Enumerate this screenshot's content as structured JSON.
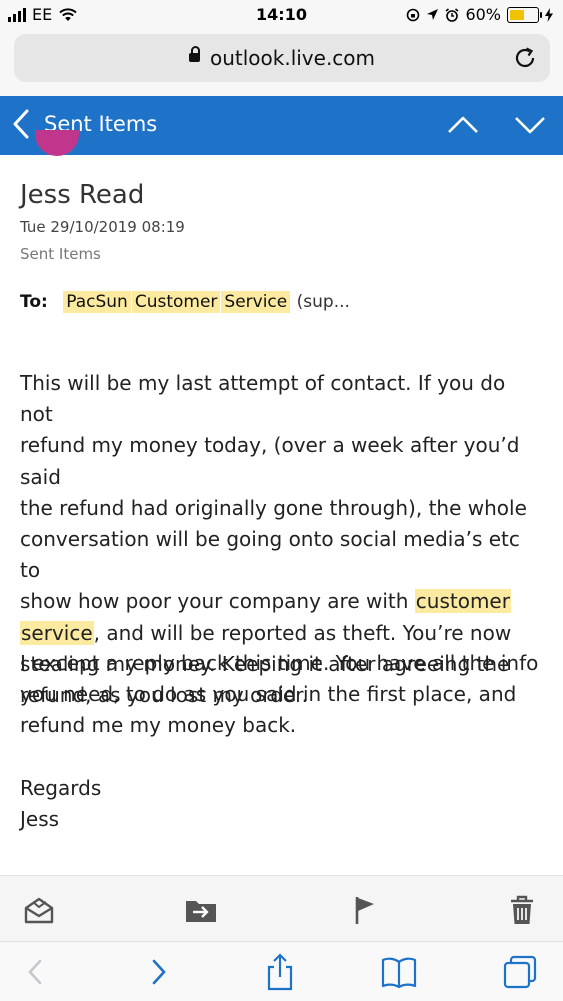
{
  "status_bar": {
    "carrier": "EE",
    "time": "14:10",
    "battery_percent": "60%",
    "battery_level": 0.6
  },
  "browser": {
    "url": "outlook.live.com"
  },
  "header": {
    "title": "Sent Items"
  },
  "email": {
    "sender": "Jess Read",
    "date": "Tue 29/10/2019 08:19",
    "folder": "Sent Items",
    "to_label": "To:",
    "to_recipient_words": [
      "PacSun",
      "Customer",
      "Service"
    ],
    "to_recipient_rest": "(sup...",
    "body": {
      "p1_line1": "This will be my last attempt of contact. If you do not",
      "p1_line2": "refund my money today, (over a week after you’d said",
      "p1_line3": "the refund had originally gone through), the whole",
      "p1_line4": "conversation will be going onto social media’s etc to",
      "p1_line5_pre": "show how poor your company are with ",
      "p1_line5_hl": "customer",
      "p1_line6_hl": "service",
      "p1_line6_post": ", and will be reported as theft. You’re now",
      "p1_line7": "stealing my money. Keeping it after agreeing the",
      "p1_line8": "refund, as you lost my order.",
      "p2_line1": "I except a reply back this time. You have all the info",
      "p2_line2": "you need, to do as you said in the first place, and",
      "p2_line3": "refund me my money back.",
      "closing": "Regards",
      "signature": "Jess"
    }
  },
  "mail_toolbar": {
    "icons": [
      "mark-read-icon",
      "move-icon",
      "flag-icon",
      "delete-icon"
    ]
  },
  "safari_toolbar": {
    "icons": [
      "back-icon",
      "forward-icon",
      "share-icon",
      "bookmarks-icon",
      "tabs-icon"
    ]
  },
  "colors": {
    "header_blue": "#1e73c9",
    "highlight": "#fbeaa0",
    "battery_yellow": "#f2c200",
    "toolbar_icon": "#555555",
    "safari_icon": "#1e73c9"
  }
}
